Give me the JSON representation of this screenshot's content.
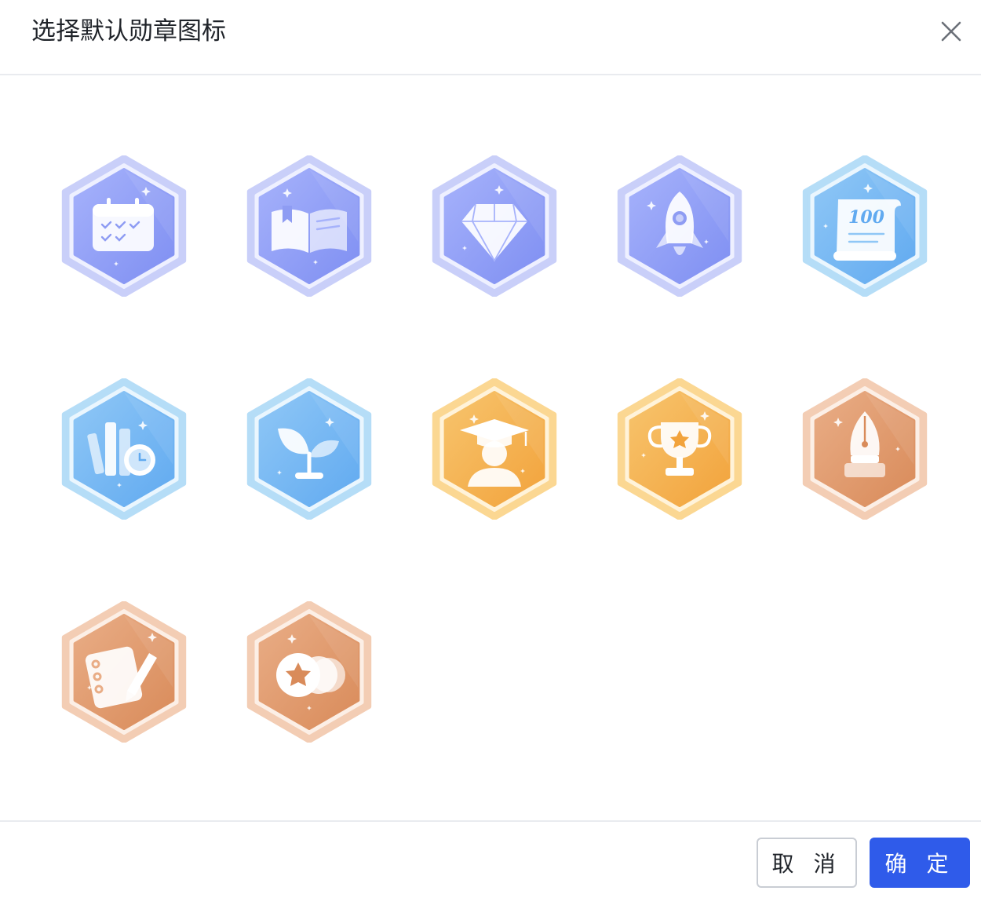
{
  "dialog": {
    "title": "选择默认勋章图标",
    "close_icon": "close-icon",
    "badges": [
      {
        "name": "calendar",
        "theme": "purple"
      },
      {
        "name": "book",
        "theme": "purple"
      },
      {
        "name": "diamond",
        "theme": "purple"
      },
      {
        "name": "rocket",
        "theme": "purple"
      },
      {
        "name": "scroll-100",
        "theme": "blue",
        "label": "100"
      },
      {
        "name": "books-clock",
        "theme": "blue"
      },
      {
        "name": "sprout",
        "theme": "blue"
      },
      {
        "name": "graduate",
        "theme": "gold"
      },
      {
        "name": "trophy",
        "theme": "gold"
      },
      {
        "name": "fountain-pen",
        "theme": "bronze"
      },
      {
        "name": "notebook-pencil",
        "theme": "bronze"
      },
      {
        "name": "star-coins",
        "theme": "bronze"
      }
    ],
    "themes": {
      "purple": {
        "outer": "#c9cff9",
        "ring": "#eef0ff",
        "inner": "#7f8ff2",
        "inner2": "#a6b2fb"
      },
      "blue": {
        "outer": "#b5ddf7",
        "ring": "#eaf6fe",
        "inner": "#61aaf0",
        "inner2": "#8fc7f6"
      },
      "gold": {
        "outer": "#fbd792",
        "ring": "#fff3da",
        "inner": "#f2a33c",
        "inner2": "#f7c46d"
      },
      "bronze": {
        "outer": "#f3cdb4",
        "ring": "#fcefe6",
        "inner": "#d98b5a",
        "inner2": "#e9ad86"
      }
    },
    "footer": {
      "cancel_label": "取 消",
      "confirm_label": "确 定"
    },
    "colors": {
      "primary": "#2f5bea",
      "border": "#c9cdd4",
      "divider": "#e9ebef"
    }
  }
}
